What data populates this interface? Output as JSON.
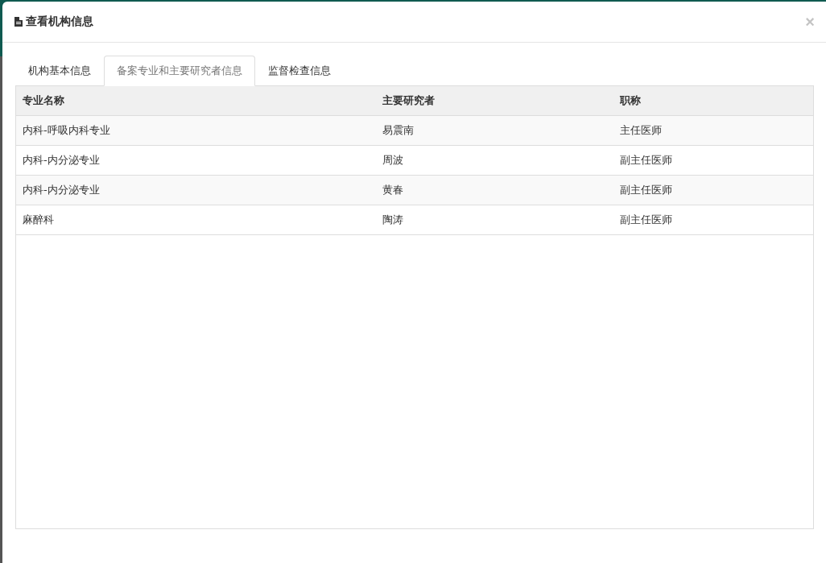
{
  "dialog": {
    "title": "查看机构信息",
    "close": "×"
  },
  "tabs": [
    {
      "label": "机构基本信息",
      "selected": false
    },
    {
      "label": "备案专业和主要研究者信息",
      "selected": true
    },
    {
      "label": "监督检查信息",
      "selected": false
    }
  ],
  "table": {
    "columns": [
      "专业名称",
      "主要研究者",
      "职称"
    ],
    "rows": [
      [
        "内科-呼吸内科专业",
        "易震南",
        "主任医师"
      ],
      [
        "内科-内分泌专业",
        "周波",
        "副主任医师"
      ],
      [
        "内科-内分泌专业",
        "黄春",
        "副主任医师"
      ],
      [
        "麻醉科",
        "陶涛",
        "副主任医师"
      ]
    ]
  }
}
